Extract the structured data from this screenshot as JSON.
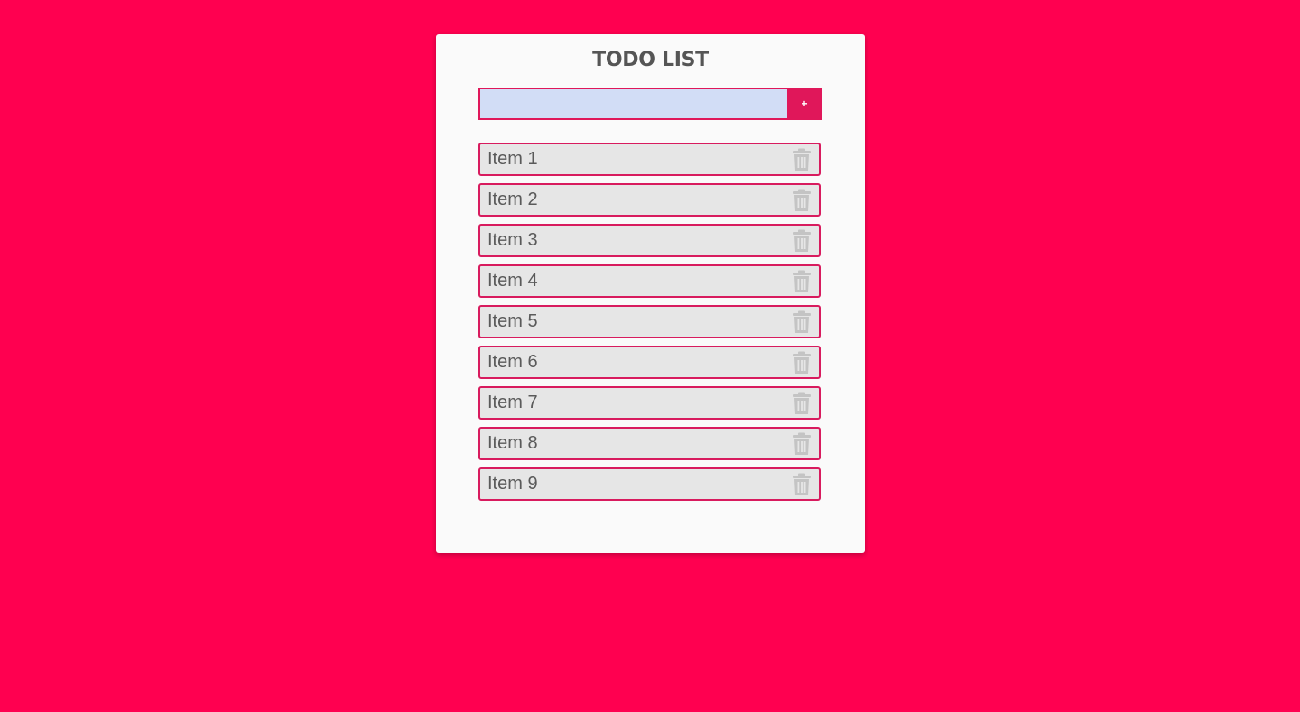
{
  "app": {
    "title": "TODO LIST"
  },
  "add": {
    "input_value": "",
    "input_placeholder": "",
    "button_label": "+"
  },
  "items": [
    {
      "label": "Item 1"
    },
    {
      "label": "Item 2"
    },
    {
      "label": "Item 3"
    },
    {
      "label": "Item 4"
    },
    {
      "label": "Item 5"
    },
    {
      "label": "Item 6"
    },
    {
      "label": "Item 7"
    },
    {
      "label": "Item 8"
    },
    {
      "label": "Item 9"
    }
  ],
  "icons": {
    "delete": "trash-icon"
  },
  "colors": {
    "background": "#ff0050",
    "accent": "#e0175a",
    "card": "#fafafa",
    "input": "#d2ddf6",
    "item": "#e6e6e6",
    "icon": "#c4c4c4"
  }
}
